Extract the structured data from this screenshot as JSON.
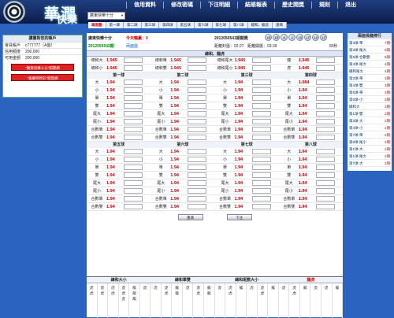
{
  "brand": {
    "logo_title": "華潤",
    "logo_sub": "快樂",
    "lottery_select": "廣東快樂十分"
  },
  "nav": [
    "信用資料",
    "修改密碼",
    "下注明細",
    "結賬報表",
    "歷史開獎",
    "規則",
    "退出"
  ],
  "subnav": [
    {
      "label": "兩面盤",
      "active": true
    },
    {
      "label": "第一球"
    },
    {
      "label": "第二球"
    },
    {
      "label": "第三球"
    },
    {
      "label": "第四球"
    },
    {
      "label": "第五球"
    },
    {
      "label": "第六球"
    },
    {
      "label": "第七球"
    },
    {
      "label": "第八球"
    },
    {
      "label": "總和、龍虎"
    },
    {
      "label": "連碼"
    }
  ],
  "account": {
    "title": "讀書對您的帳戶",
    "rows": [
      {
        "k": "會員帳戶",
        "v": "c777777（A盤）"
      },
      {
        "k": "信用額度",
        "v": "200,000"
      },
      {
        "k": "可用金額",
        "v": "200,000"
      }
    ],
    "buttons": [
      "“廣東快樂十分”開獎網",
      "“重慶時時彩”開獎網"
    ]
  },
  "info": {
    "game": "廣東快樂十分",
    "today": "今天輸贏：0",
    "issue": "2012050542期",
    "mode": "兩面盤",
    "last_issue": "2012050541期開獎",
    "close": "距離封盤：02:27",
    "open": "距離開獎：03:39",
    "count": "83秒",
    "balls": [
      "15",
      "15",
      "8",
      "2",
      "13",
      "17",
      "12",
      "17"
    ]
  },
  "total": {
    "title": "總和、龍虎",
    "rows": [
      [
        {
          "l": "總和大",
          "o": "1.945"
        },
        {
          "l": "總和單",
          "o": "1.945"
        },
        {
          "l": "總和尾大",
          "o": "1.945"
        },
        {
          "l": "龍",
          "o": "1.945"
        }
      ],
      [
        {
          "l": "總和小",
          "o": "1.945"
        },
        {
          "l": "總和雙",
          "o": "1.945"
        },
        {
          "l": "總和尾小",
          "o": "1.945"
        },
        {
          "l": "虎",
          "o": "1.945"
        }
      ]
    ]
  },
  "balls_a": {
    "heads": [
      "第一球",
      "第二球",
      "第三球",
      "第四球"
    ],
    "labels": [
      "大",
      "小",
      "單",
      "雙",
      "尾大",
      "尾小",
      "合數單",
      "合數雙"
    ],
    "odds": [
      [
        "1.94",
        "1.94",
        "1.94",
        "1.984"
      ],
      [
        "1.94",
        "1.94",
        "1.94",
        "1.94"
      ],
      [
        "1.94",
        "1.94",
        "1.94",
        "1.94"
      ],
      [
        "1.94",
        "1.94",
        "1.94",
        "1.94"
      ],
      [
        "1.94",
        "1.94",
        "1.94",
        "1.94"
      ],
      [
        "1.94",
        "1.94",
        "1.94",
        "1.94"
      ],
      [
        "1.94",
        "1.94",
        "1.94",
        "1.94"
      ],
      [
        "1.94",
        "1.94",
        "1.94",
        "1.94"
      ]
    ]
  },
  "balls_b": {
    "heads": [
      "第五球",
      "第六球",
      "第七球",
      "第八球"
    ],
    "labels": [
      "大",
      "小",
      "單",
      "雙",
      "尾大",
      "尾小",
      "合數單",
      "合數雙"
    ],
    "odds": [
      [
        "1.94",
        "1.94",
        "1.94",
        "1.94"
      ],
      [
        "1.94",
        "1.94",
        "1.94",
        "1.94"
      ],
      [
        "1.94",
        "1.94",
        "1.94",
        "1.94"
      ],
      [
        "1.94",
        "1.94",
        "1.94",
        "1.94"
      ],
      [
        "1.94",
        "1.94",
        "1.94",
        "1.94"
      ],
      [
        "1.94",
        "1.94",
        "1.94",
        "1.94"
      ],
      [
        "1.94",
        "1.94",
        "1.94",
        "1.94"
      ],
      [
        "1.94",
        "1.94",
        "1.94",
        "1.94"
      ]
    ]
  },
  "actions": {
    "reset": "重填",
    "submit": "下注"
  },
  "bottom": {
    "heads": [
      "總和大小",
      "總和單雙",
      "總和尾數大小",
      "龍虎"
    ],
    "cols": [
      [
        "虎",
        "虎"
      ],
      [
        "虎",
        "虎"
      ],
      [
        "虎",
        "虎"
      ],
      [
        "虎",
        "虎",
        "虎"
      ],
      [
        "龍",
        "龍",
        "龍"
      ],
      [
        "虎"
      ],
      [
        "虎"
      ],
      [
        "虎",
        "虎"
      ],
      [
        "龍",
        "龍"
      ],
      [
        "虎"
      ],
      [
        "虎",
        "虎"
      ],
      [
        "龍",
        "龍"
      ],
      [
        "虎"
      ],
      [
        "虎",
        "虎"
      ],
      [
        "龍"
      ],
      [
        "虎"
      ],
      [
        "虎",
        "虎"
      ],
      [
        "龍"
      ],
      [
        "虎"
      ],
      [
        "虎",
        "虎"
      ],
      [
        "龍"
      ],
      [
        "虎"
      ],
      [
        "虎"
      ],
      [
        "龍"
      ]
    ]
  },
  "longdragon": {
    "title": "兩面長龍排行",
    "rows": [
      {
        "n": "第3球-單",
        "v": "7期"
      },
      {
        "n": "第3球-尾大",
        "v": "6期"
      },
      {
        "n": "第6球-合數雙",
        "v": "5期"
      },
      {
        "n": "第4球-尾大",
        "v": "4期"
      },
      {
        "n": "總和尾大",
        "v": "4期"
      },
      {
        "n": "第2球-單",
        "v": "3期"
      },
      {
        "n": "第4球-雙",
        "v": "3期"
      },
      {
        "n": "第5球-單",
        "v": "3期"
      },
      {
        "n": "第6球-小",
        "v": "3期"
      },
      {
        "n": "總和大",
        "v": "3期"
      },
      {
        "n": "第1球-雙",
        "v": "2期"
      },
      {
        "n": "第3球-大",
        "v": "2期"
      },
      {
        "n": "第4球-小",
        "v": "2期"
      },
      {
        "n": "第7球-單",
        "v": "2期"
      },
      {
        "n": "第8球-尾小",
        "v": "2期"
      },
      {
        "n": "第1球-大",
        "v": "2期"
      },
      {
        "n": "第1球-尾大",
        "v": "2期"
      },
      {
        "n": "第7球-大",
        "v": "2期"
      }
    ]
  }
}
